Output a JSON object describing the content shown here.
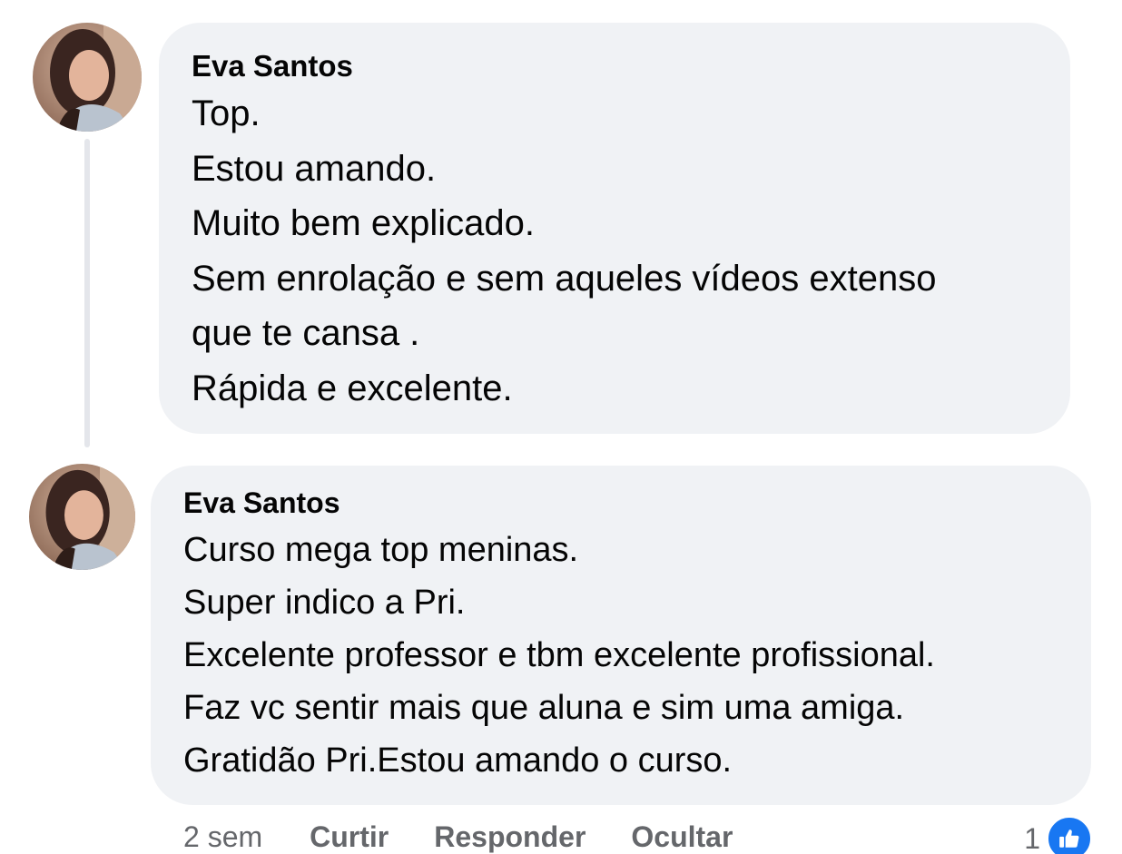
{
  "comments": [
    {
      "author": "Eva Santos",
      "lines": [
        "Top.",
        "Estou amando.",
        "Muito bem explicado.",
        "Sem enrolação e sem aqueles vídeos extenso",
        "que te cansa .",
        "Rápida e excelente."
      ]
    },
    {
      "author": "Eva Santos",
      "lines": [
        "Curso mega top meninas.",
        "Super indico a Pri.",
        "Excelente professor e tbm excelente profissional.",
        "Faz vc sentir mais que aluna e sim uma amiga.",
        "Gratidão Pri.Estou amando o curso."
      ]
    }
  ],
  "actions": {
    "time": "2 sem",
    "like_label": "Curtir",
    "reply_label": "Responder",
    "hide_label": "Ocultar"
  },
  "reactions": {
    "count": "1",
    "icon": "thumbs-up-icon"
  },
  "colors": {
    "bubble": "#f0f2f5",
    "secondary_text": "#65676b",
    "like_blue": "#1877f2"
  }
}
